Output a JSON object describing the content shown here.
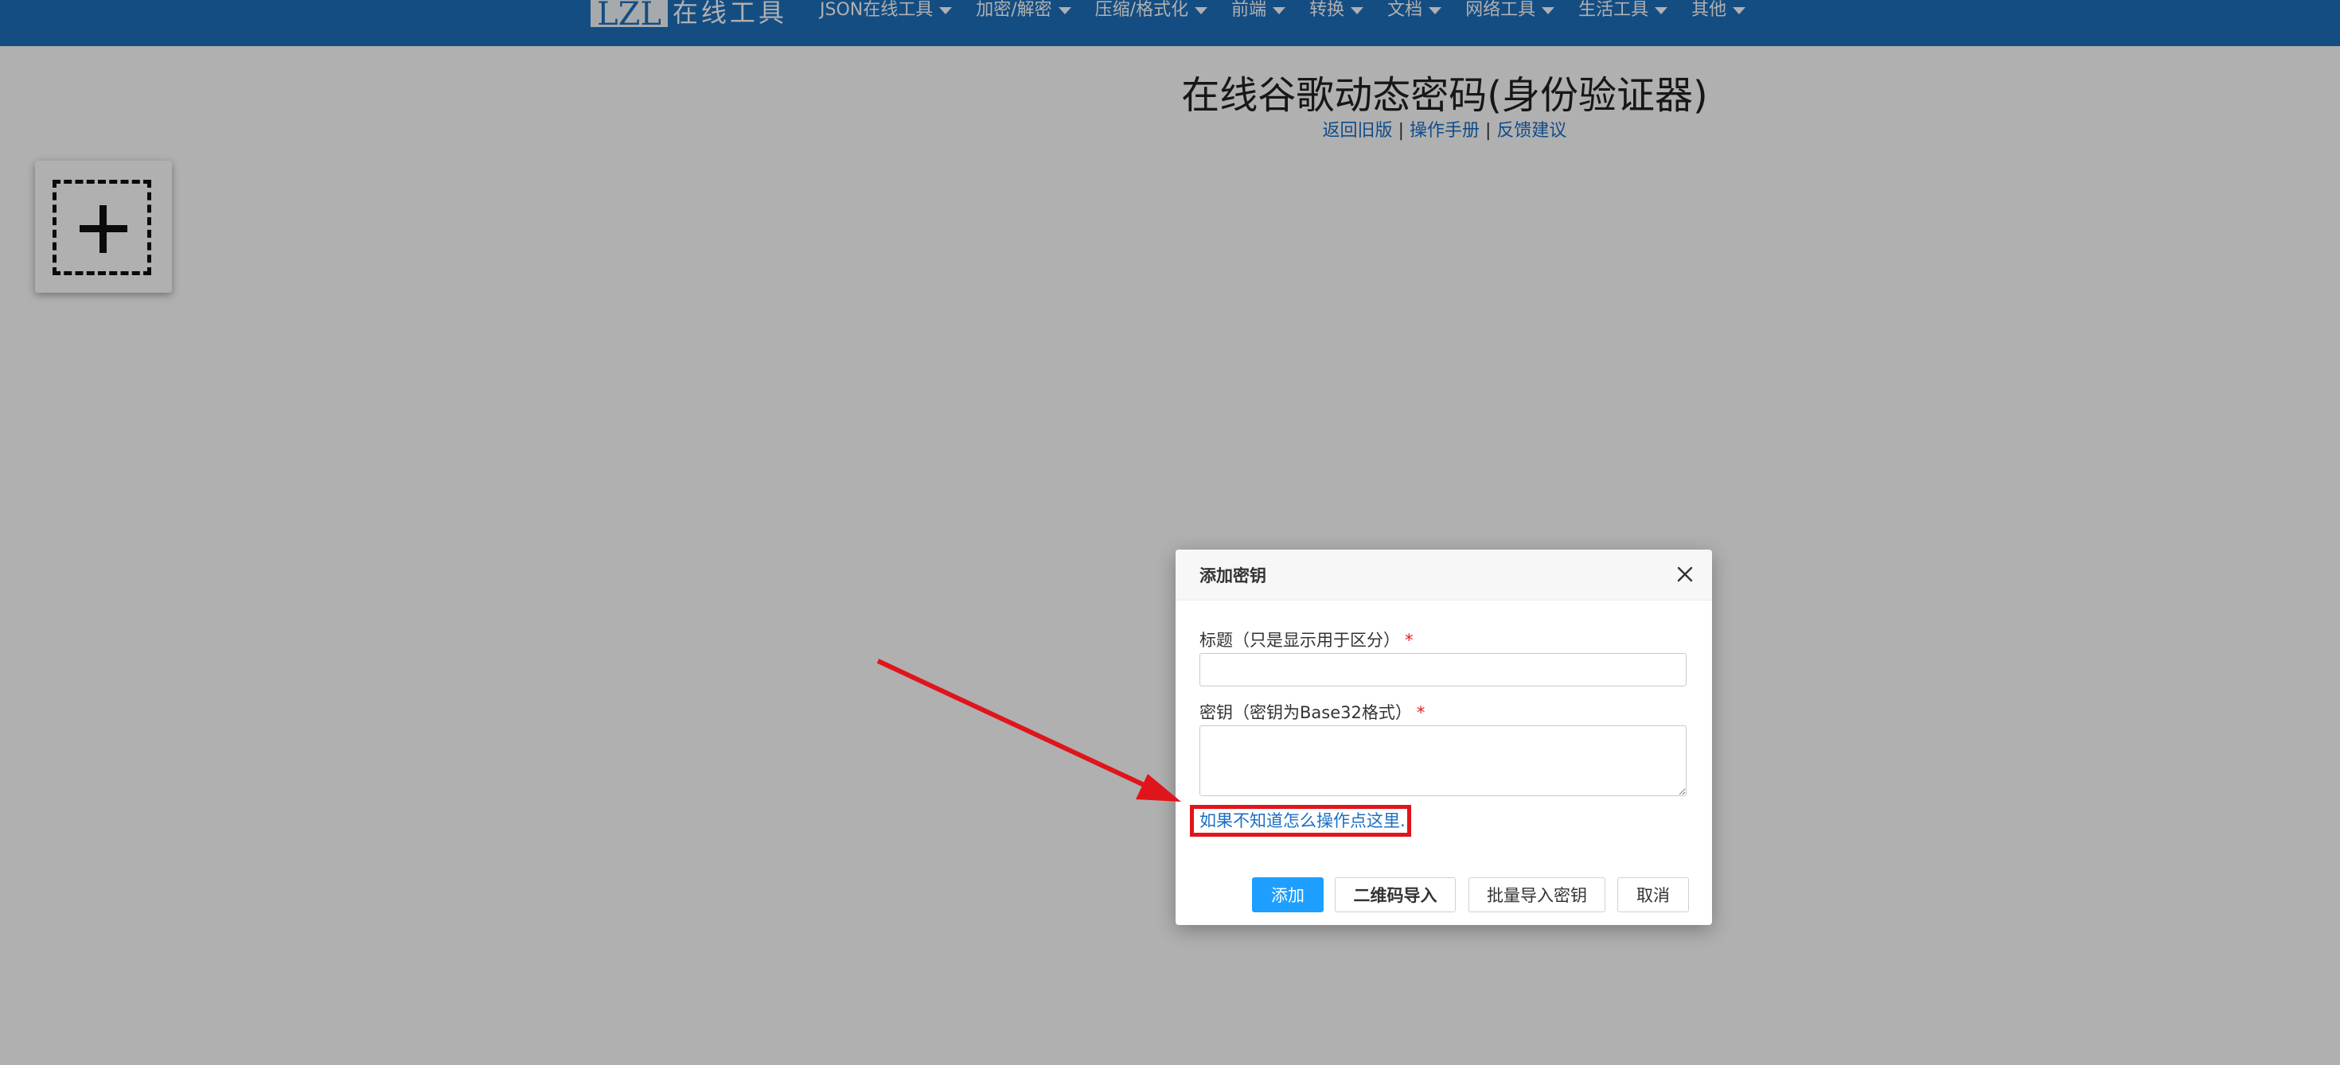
{
  "navbar": {
    "logo_box": "LZL",
    "logo_text": "在线工具",
    "items": [
      {
        "label": "JSON在线工具"
      },
      {
        "label": "加密/解密"
      },
      {
        "label": "压缩/格式化"
      },
      {
        "label": "前端"
      },
      {
        "label": "转换"
      },
      {
        "label": "文档"
      },
      {
        "label": "网络工具"
      },
      {
        "label": "生活工具"
      },
      {
        "label": "其他"
      }
    ]
  },
  "page": {
    "title": "在线谷歌动态密码(身份验证器)",
    "links": [
      {
        "label": "返回旧版"
      },
      {
        "label": "操作手册"
      },
      {
        "label": "反馈建议"
      }
    ],
    "link_separator": "|"
  },
  "add_card": {
    "icon": "plus-icon"
  },
  "modal": {
    "title": "添加密钥",
    "title_field": {
      "label": "标题（只是显示用于区分）",
      "required_mark": "*",
      "value": ""
    },
    "secret_field": {
      "label": "密钥（密钥为Base32格式）",
      "required_mark": "*",
      "value": ""
    },
    "help_link": "如果不知道怎么操作点这里...",
    "buttons": {
      "add": "添加",
      "qr_import": "二维码导入",
      "batch_import": "批量导入密钥",
      "cancel": "取消"
    }
  },
  "colors": {
    "navbar": "#1e70bd",
    "primary_button": "#1e9fff",
    "annotation": "#e0151b",
    "link": "#1a6fc4"
  }
}
